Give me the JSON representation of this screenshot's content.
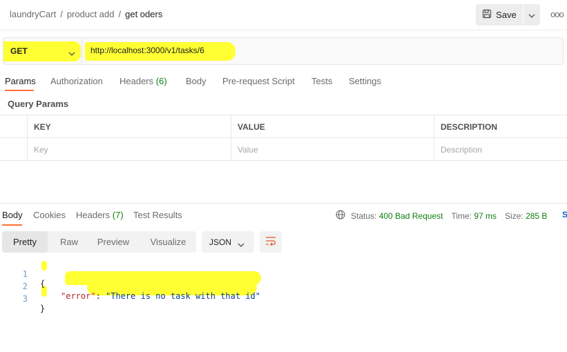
{
  "breadcrumb": {
    "items": [
      "laundryCart",
      "product add",
      "get oders"
    ],
    "separator": "/"
  },
  "toolbar": {
    "save_label": "Save",
    "more_label": "ooo"
  },
  "request": {
    "method": "GET",
    "url": "http://localhost:3000/v1/tasks/6"
  },
  "request_tabs": {
    "params": "Params",
    "authorization": "Authorization",
    "headers": "Headers",
    "headers_count": "(6)",
    "body": "Body",
    "prerequest": "Pre-request Script",
    "tests": "Tests",
    "settings": "Settings",
    "active": "Params"
  },
  "query_params": {
    "title": "Query Params",
    "columns": [
      "KEY",
      "VALUE",
      "DESCRIPTION"
    ],
    "placeholders": [
      "Key",
      "Value",
      "Description"
    ]
  },
  "response_tabs": {
    "body": "Body",
    "cookies": "Cookies",
    "headers": "Headers",
    "headers_count": "(7)",
    "test_results": "Test Results",
    "active": "Body"
  },
  "response_status": {
    "status_label": "Status:",
    "status_value": "400 Bad Request",
    "time_label": "Time:",
    "time_value": "97 ms",
    "size_label": "Size:",
    "size_value": "285 B",
    "save_link": "S"
  },
  "view_modes": {
    "pretty": "Pretty",
    "raw": "Raw",
    "preview": "Preview",
    "visualize": "Visualize",
    "active": "Pretty"
  },
  "format": {
    "selected": "JSON"
  },
  "response_body": {
    "line_numbers": [
      "1",
      "2",
      "3"
    ],
    "open_brace": "{",
    "key": "\"error\"",
    "colon": ": ",
    "value": "\"There is no task with that id\"",
    "close_brace": "}"
  },
  "colors": {
    "accent": "#ff6c37",
    "highlight": "#ffff33",
    "status_ok": "#0f7e0f",
    "link": "#0265d2"
  },
  "icons": [
    "save-icon",
    "chevron-down-icon",
    "more-icon",
    "globe-icon",
    "wrap-lines-icon"
  ]
}
